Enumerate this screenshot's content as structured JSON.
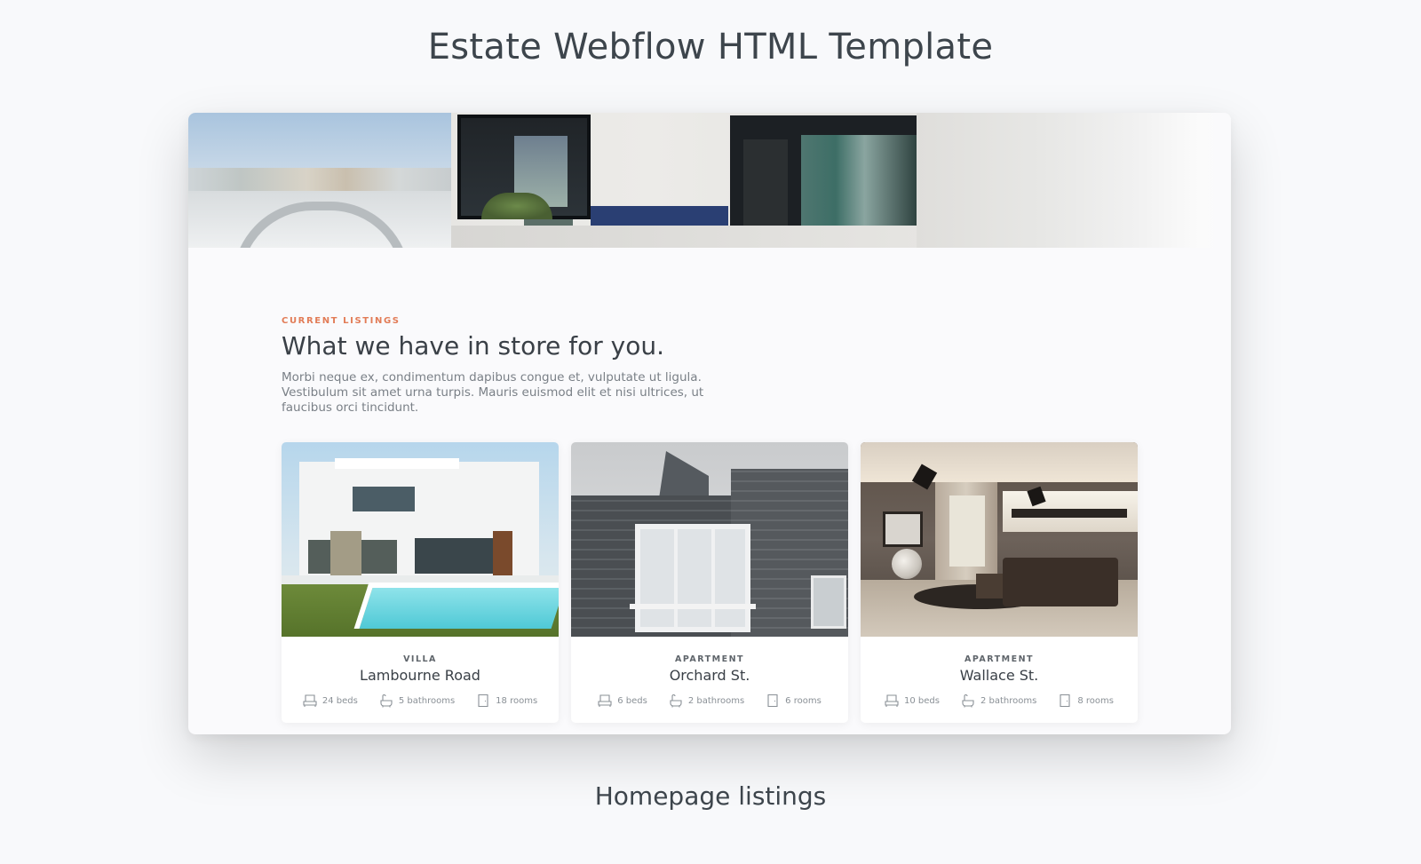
{
  "page": {
    "title": "Estate Webflow HTML Template",
    "caption": "Homepage listings"
  },
  "section": {
    "eyebrow": "CURRENT LISTINGS",
    "heading": "What we have in store for you.",
    "body": "Morbi neque ex, condimentum dapibus congue et, vulputate ut ligula. Vestibulum sit amet urna turpis. Mauris euismod elit et nisi ultrices, ut faucibus orci tincidunt."
  },
  "listings": [
    {
      "type": "VILLA",
      "name": "Lambourne Road",
      "beds": "24 beds",
      "bathrooms": "5 bathrooms",
      "rooms": "18 rooms"
    },
    {
      "type": "APARTMENT",
      "name": "Orchard St.",
      "beds": "6 beds",
      "bathrooms": "2 bathrooms",
      "rooms": "6 rooms"
    },
    {
      "type": "APARTMENT",
      "name": "Wallace St.",
      "beds": "10 beds",
      "bathrooms": "2 bathrooms",
      "rooms": "8 rooms"
    }
  ],
  "icons": {
    "beds": "bed-icon",
    "bathrooms": "bathtub-icon",
    "rooms": "door-icon"
  },
  "colors": {
    "accent": "#e27c57",
    "heading": "#3a4047",
    "body_text": "#7a8087"
  }
}
